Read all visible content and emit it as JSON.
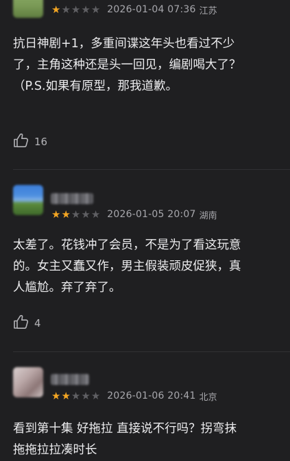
{
  "reviews": [
    {
      "stars_filled": 1,
      "stars_total": 5,
      "date": "2026-01-04 07:36",
      "region": "江苏",
      "content_lines": [
        "抗日神剧+1，多重间谍这年头也看过不少",
        "了，主角这种还是头一回见，编剧喝大了？",
        "（P.S.如果有原型，那我道歉。"
      ],
      "likes": "16"
    },
    {
      "stars_filled": 2,
      "stars_total": 5,
      "date": "2026-01-05 20:07",
      "region": "湖南",
      "content_lines": [
        "太差了。花钱冲了会员，不是为了看这玩意",
        "的。女主又蠢又作，男主假装顽皮促狭，真",
        "人尴尬。弃了弃了。"
      ],
      "likes": "4"
    },
    {
      "stars_filled": 2,
      "stars_total": 5,
      "date": "2026-01-06 20:41",
      "region": "北京",
      "content_lines": [
        "看到第十集 好拖拉 直接说不行吗？拐弯抹",
        "拖拖拉拉凑时长"
      ],
      "likes": ""
    }
  ],
  "colors": {
    "star_on": "#f4a623",
    "star_off": "#5f5f63",
    "background": "#1f1f21"
  },
  "icons": {
    "like": "thumbs-up-icon",
    "star": "star-icon"
  }
}
